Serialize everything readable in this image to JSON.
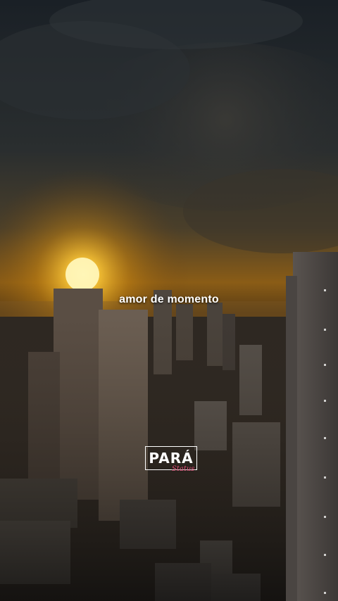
{
  "scene": {
    "caption": "amor de momento"
  },
  "logo": {
    "main": "PARÁ",
    "sub": "Status"
  },
  "colors": {
    "sky_top": "#1b2127",
    "sun": "#ffd24a",
    "horizon": "#c07a14",
    "logo_accent": "#e8517a"
  }
}
